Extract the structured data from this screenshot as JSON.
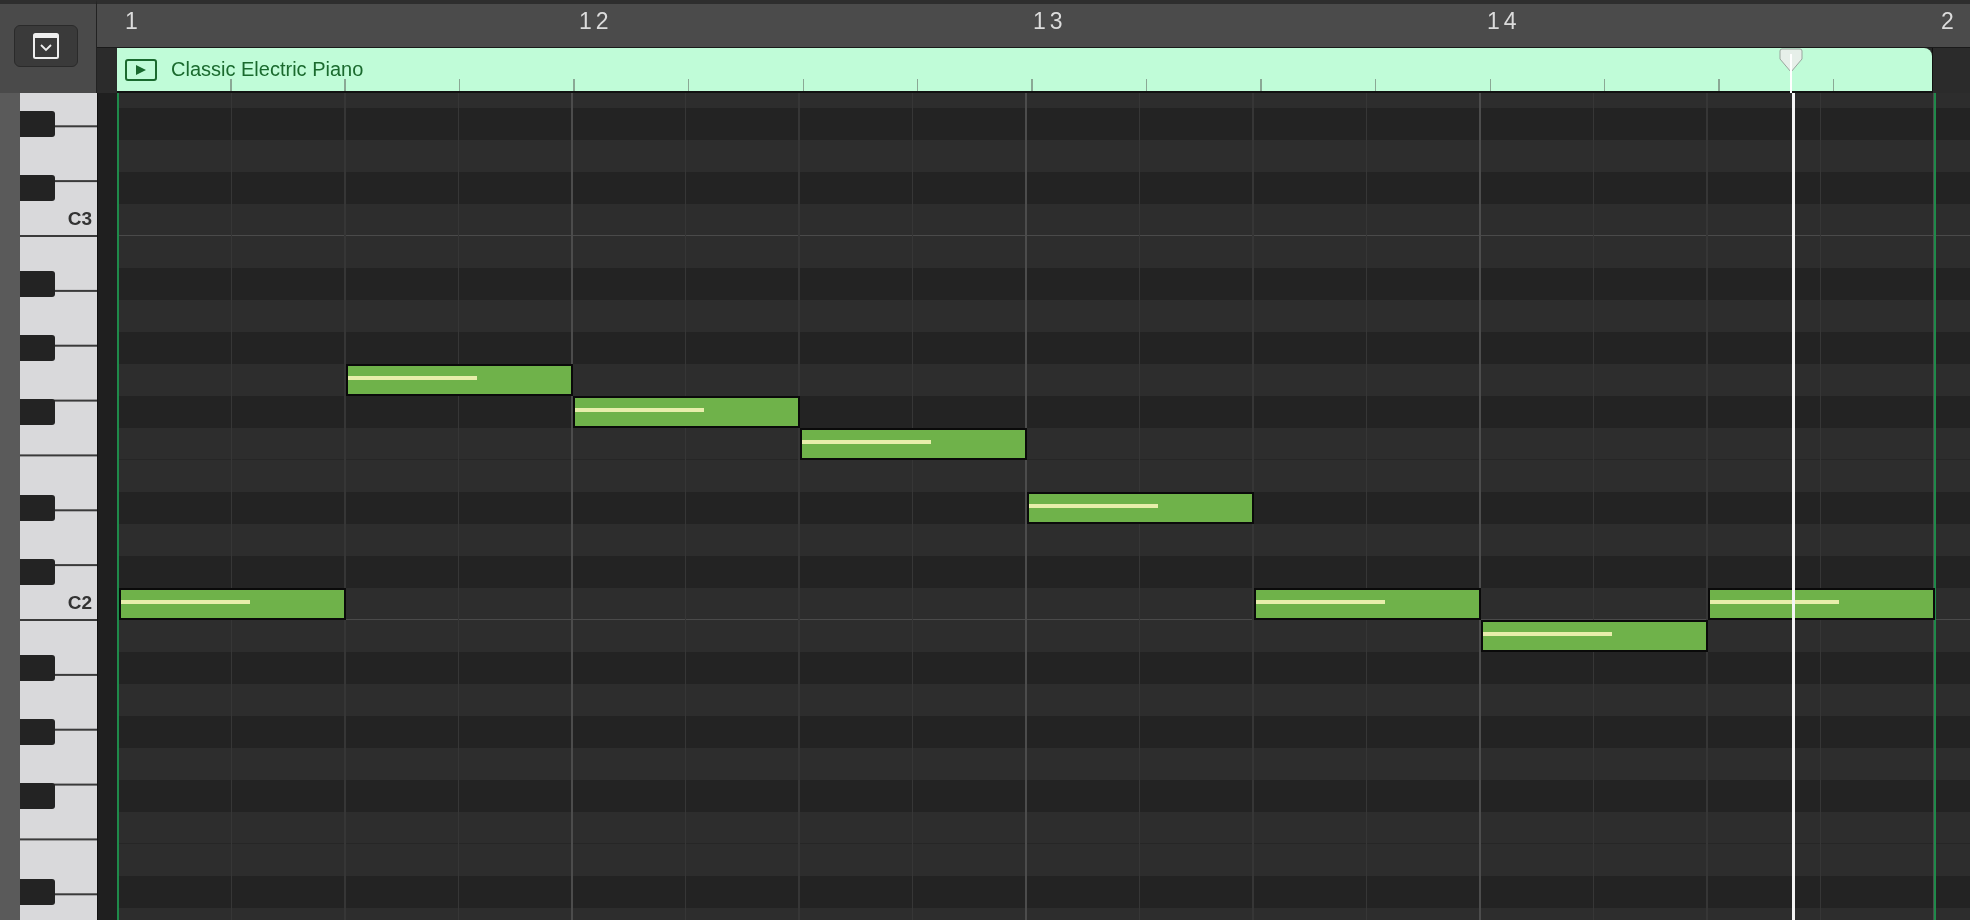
{
  "ruler": {
    "bars": [
      {
        "label": "1"
      },
      {
        "label": "12"
      },
      {
        "label": "13"
      },
      {
        "label": "14"
      },
      {
        "label": "2"
      }
    ]
  },
  "region": {
    "name": "Classic Electric Piano"
  },
  "keyboard": {
    "labels": [
      {
        "text": "C3"
      },
      {
        "text": "C2"
      }
    ]
  },
  "notes": [
    {
      "level": 0.58
    },
    {
      "level": 0.58
    },
    {
      "level": 0.58
    },
    {
      "level": 0.58
    },
    {
      "level": 0.58
    },
    {
      "level": 0.58
    },
    {
      "level": 0.58
    },
    {
      "level": 0.58
    }
  ]
}
